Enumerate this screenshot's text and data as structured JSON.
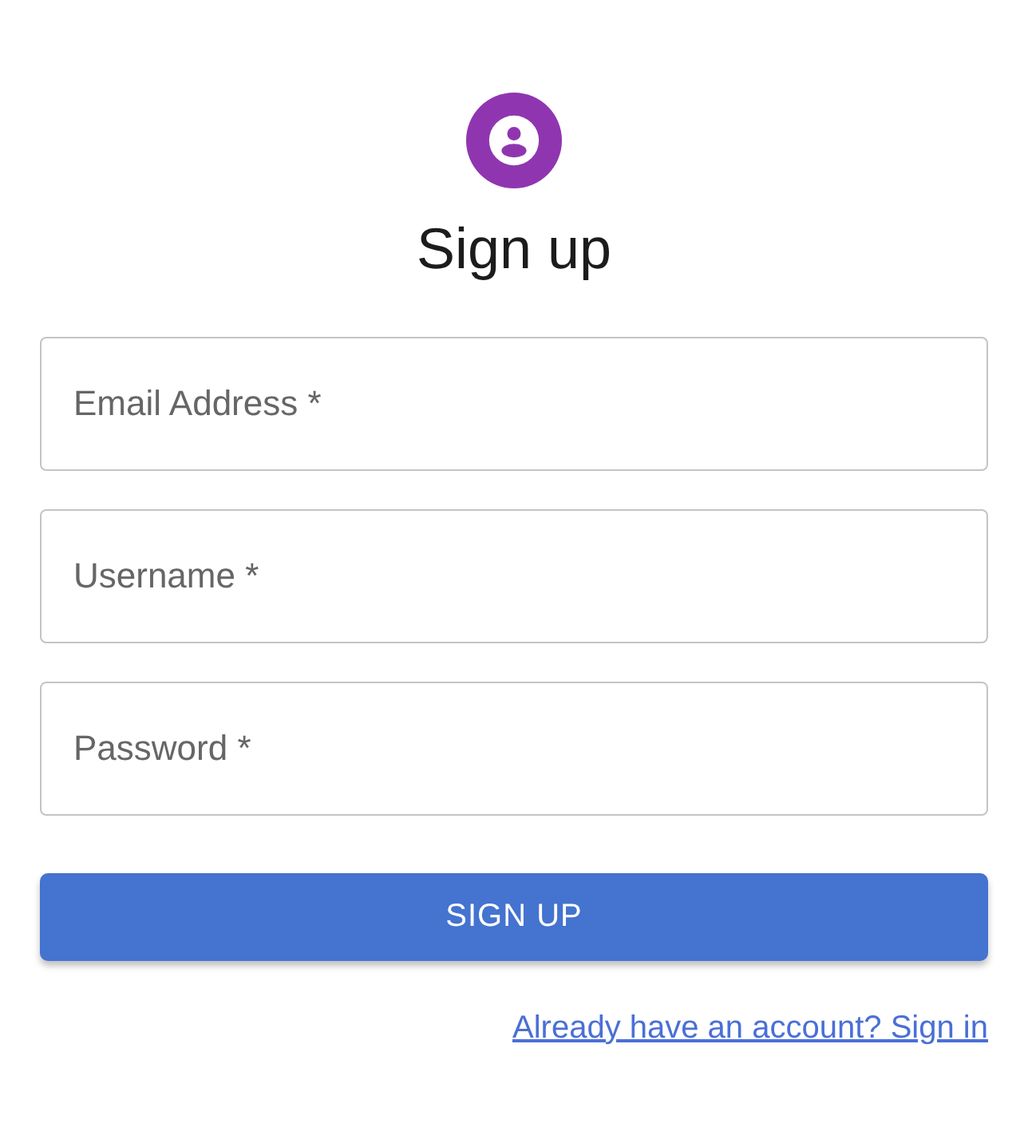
{
  "title": "Sign up",
  "fields": [
    {
      "placeholder": "Email Address *"
    },
    {
      "placeholder": "Username *"
    },
    {
      "placeholder": "Password *"
    }
  ],
  "submit_button": "SIGN UP",
  "link": "Already have an account? Sign in"
}
